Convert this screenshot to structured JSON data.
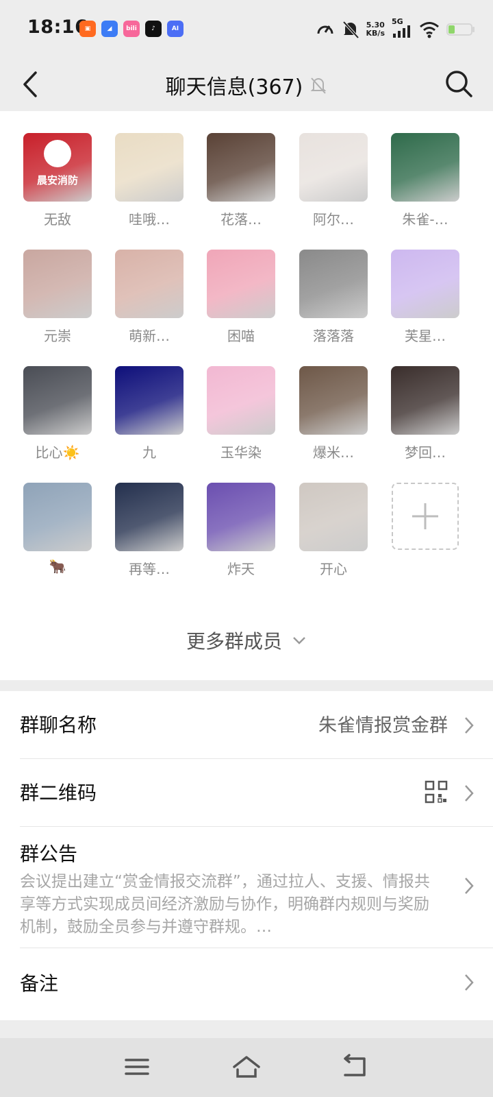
{
  "status_bar": {
    "time": "18:16",
    "net_speed_value": "5.30",
    "net_speed_unit": "KB/s",
    "network": "5G",
    "apps": [
      {
        "icon": "kuaishou-icon",
        "color": "#ff6a20",
        "label": ""
      },
      {
        "icon": "browser-icon",
        "color": "#3d7cf5",
        "label": ""
      },
      {
        "icon": "bilibili-icon",
        "color": "#f7679a",
        "label": "bili"
      },
      {
        "icon": "tiktok-icon",
        "color": "#111111",
        "label": ""
      },
      {
        "icon": "ai-assistant-icon",
        "color": "#4c6ef5",
        "label": "AI"
      }
    ]
  },
  "header": {
    "title": "聊天信息(367)",
    "muted_icon": "bell-slash-icon",
    "back_icon": "back-arrow-icon",
    "search_icon": "search-icon"
  },
  "members": [
    {
      "name": "无敌",
      "avatar": "fire-safety-logo",
      "color": "#c8202a",
      "avatar_text": "晨安消防"
    },
    {
      "name": "哇哦…",
      "avatar": "cat-drawing",
      "color": "#e9dcc4"
    },
    {
      "name": "花落…",
      "avatar": "ink-portrait",
      "color": "#5a4236"
    },
    {
      "name": "阿尔…",
      "avatar": "anime-boy-white",
      "color": "#e8e2de"
    },
    {
      "name": "朱雀-…",
      "avatar": "anime-boy-green",
      "color": "#2f6b4b"
    },
    {
      "name": "元崇",
      "avatar": "anime-couple",
      "color": "#c9a7a0"
    },
    {
      "name": "萌新…",
      "avatar": "anime-boy-pink",
      "color": "#d8b2a8"
    },
    {
      "name": "困喵",
      "avatar": "anime-girl-pink-hair",
      "color": "#f0a6b8"
    },
    {
      "name": "落落落",
      "avatar": "monochrome-anime",
      "color": "#8a8a8a"
    },
    {
      "name": "芙星…",
      "avatar": "anime-girl-lavender",
      "color": "#cdb8ef"
    },
    {
      "name": "比心☀️",
      "avatar": "man-photo",
      "color": "#4a4d55"
    },
    {
      "name": "九",
      "avatar": "night-rain",
      "color": "#0e0f7a"
    },
    {
      "name": "玉华染",
      "avatar": "anime-girl-buns",
      "color": "#f2b8d2"
    },
    {
      "name": "爆米…",
      "avatar": "cat-photo",
      "color": "#6e5848"
    },
    {
      "name": "梦回…",
      "avatar": "man-headphones",
      "color": "#3a2e2c"
    },
    {
      "name": "🐂",
      "avatar": "rainbow-city",
      "color": "#8fa3b8"
    },
    {
      "name": "再等…",
      "avatar": "starry-pirate",
      "color": "#24304e"
    },
    {
      "name": "炸天",
      "avatar": "kids-photo",
      "color": "#6b4fb0"
    },
    {
      "name": "开心",
      "avatar": "anime-girl-silver",
      "color": "#cfc8c2"
    }
  ],
  "add_member_icon": "plus-icon",
  "more_members": "更多群成员",
  "settings": {
    "group_name_label": "群聊名称",
    "group_name_value": "朱雀情报赏金群",
    "qr_label": "群二维码",
    "qr_icon": "qr-code-icon",
    "notice_label": "群公告",
    "notice_text": "会议提出建立“赏金情报交流群”，通过拉人、支援、情报共享等方式实现成员间经济激励与协作，明确群内规则与奖励机制，鼓励全员参与并遵守群规。…",
    "remark_label": "备注"
  },
  "nav": {
    "menu_icon": "menu-icon",
    "home_icon": "home-icon",
    "back_icon": "return-icon"
  }
}
